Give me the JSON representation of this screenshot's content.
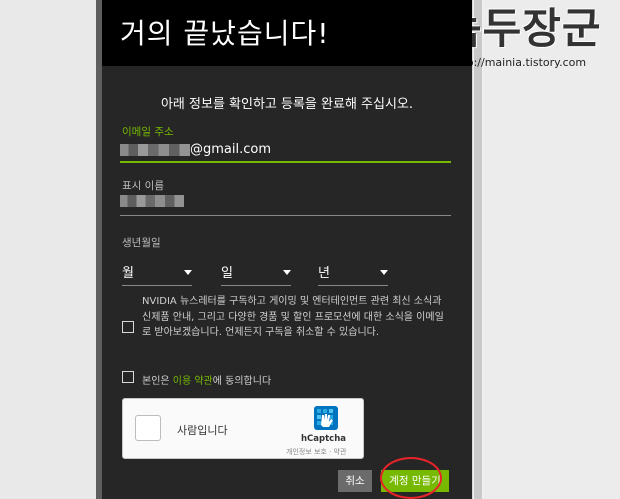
{
  "header": {
    "title": "거의 끝났습니다!"
  },
  "form": {
    "subtitle": "아래 정보를 확인하고 등록을 완료해 주십시오.",
    "email": {
      "label": "이메일 주소",
      "value_suffix": "@gmail.com"
    },
    "display_name": {
      "label": "표시 이름"
    },
    "birthdate": {
      "label": "생년월일",
      "month": "월",
      "day": "일",
      "year": "년"
    },
    "newsletter_consent": "NVIDIA 뉴스레터를 구독하고 게이밍 및 엔터테인먼트 관련 최신 소식과 신제품 안내, 그리고 다양한 경품 및 할인 프로모션에 대한 소식을 이메일로 받아보겠습니다. 언제든지 구독을 취소할 수 있습니다.",
    "terms": {
      "prefix": "본인은 ",
      "link": "이용 약관",
      "suffix": "에 동의합니다"
    },
    "captcha": {
      "label": "사람입니다",
      "brand": "hCaptcha",
      "footer": "개인정보 보호 · 약관"
    },
    "buttons": {
      "cancel": "취소",
      "create": "계정 만들기"
    }
  },
  "watermark": {
    "title": "녹두장군",
    "url": "http://mainia.tistory.com"
  },
  "colors": {
    "accent": "#76b900",
    "header_bg": "#000000",
    "panel_bg": "#262626",
    "annotation": "#e8242a"
  }
}
